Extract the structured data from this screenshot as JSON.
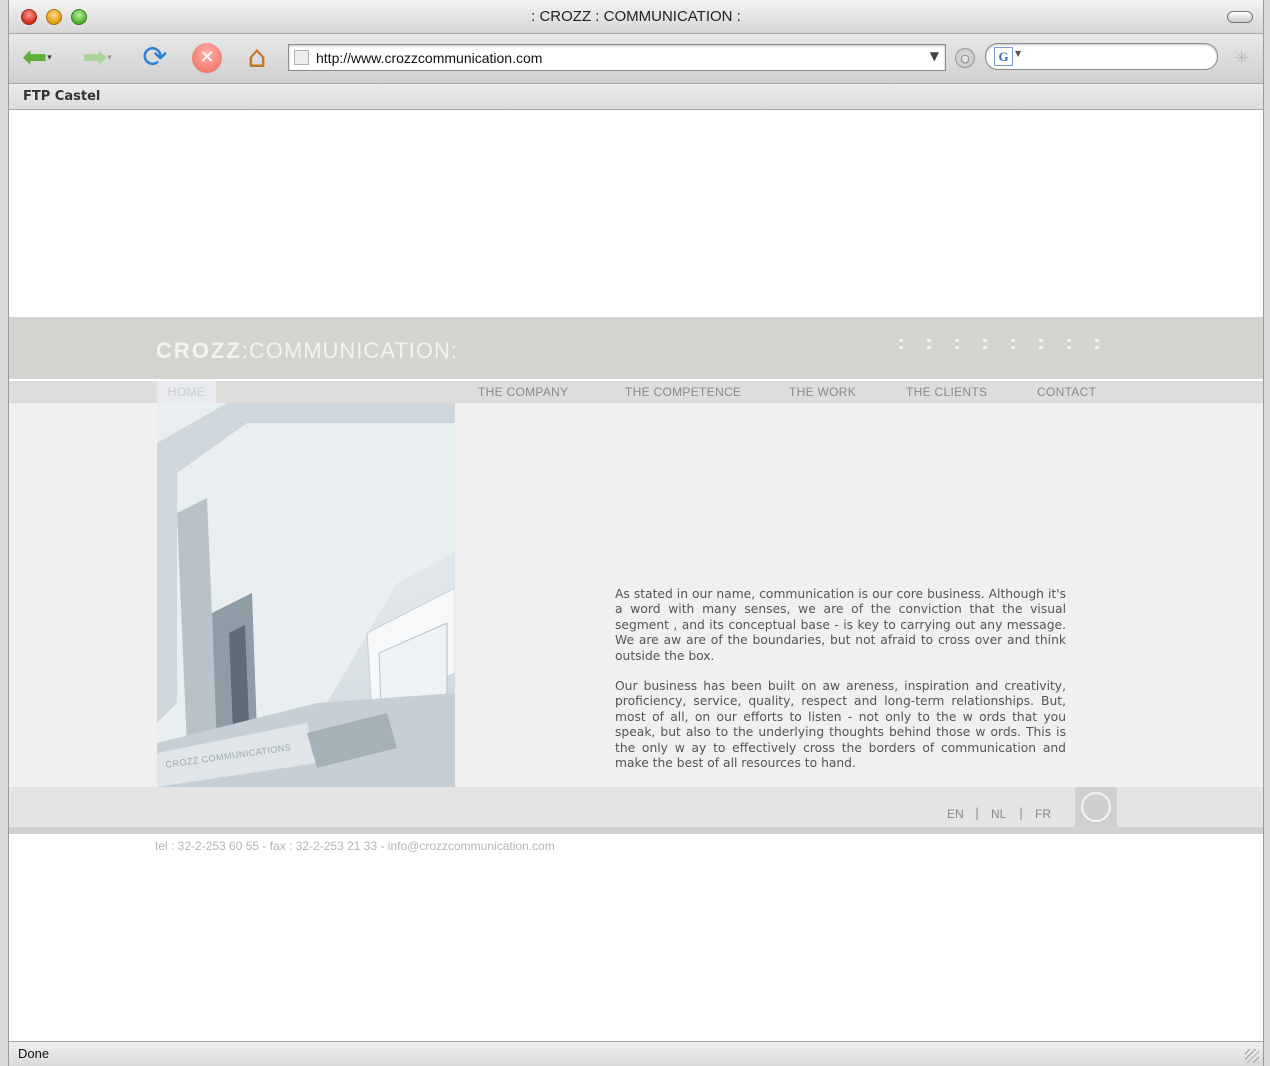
{
  "window": {
    "title": ": CROZZ : COMMUNICATION :"
  },
  "toolbar": {
    "url": "http://www.crozzcommunication.com",
    "search_engine": "G"
  },
  "bookmarks": {
    "items": [
      "FTP Castel"
    ]
  },
  "site": {
    "logo_part1": "CROZZ",
    "logo_part2": ":COMMUNICATION:",
    "nav": [
      "HOME",
      "THE COMPANY",
      "THE COMPETENCE",
      "THE WORK",
      "THE CLIENTS",
      "CONTACT"
    ],
    "active_nav": "HOME",
    "paragraphs": [
      "As stated in our name, communication is our core business. Although it's a word with many senses, we are of the conviction that the visual segment , and its conceptual base - is key to carrying out any message. We are aw are of the boundaries, but not afraid to cross over and think outside the box.",
      "Our business has been built on aw areness, inspiration and creativity, proficiency, service, quality, respect and long-term relationships. But, most of all, on our efforts to listen - not only to the w ords that you speak, but also to the underlying thoughts behind those w ords. This is the only w ay to effectively cross the borders of communication and make the best of all resources to hand."
    ],
    "languages": [
      "EN",
      "NL",
      "FR"
    ],
    "lang_separator": "|",
    "contact_line": "tel : 32-2-253 60 55 - fax : 32-2-253 21 33 - info@crozzcommunication.com",
    "photo_sign": "CROZZ COMMUNICATIONS"
  },
  "status": {
    "text": "Done"
  },
  "icons": {
    "back": "arrow-left-icon",
    "forward": "arrow-right-icon",
    "reload": "reload-icon",
    "stop": "stop-icon",
    "home": "home-icon"
  }
}
